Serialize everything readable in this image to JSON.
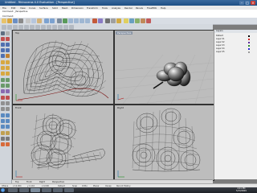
{
  "window": {
    "title": "Untitled - Rhinoceros 4.0 Evaluation - [Perspective]"
  },
  "menu": [
    "File",
    "Edit",
    "View",
    "Curve",
    "Surface",
    "Solid",
    "Mesh",
    "Dimension",
    "Transform",
    "Tools",
    "Analyze",
    "Render",
    "Panels",
    "FlowEDK",
    "Help"
  ],
  "command": {
    "history": "Command: _Perspective",
    "prompt": "Command:"
  },
  "viewports": [
    {
      "title": "Top"
    },
    {
      "title": "Perspective"
    },
    {
      "title": "Front"
    },
    {
      "title": "Right"
    }
  ],
  "layers": {
    "header": "Layers",
    "items": [
      {
        "name": "Default",
        "color": "#000000"
      },
      {
        "name": "Layer 01",
        "color": "#d22222"
      },
      {
        "name": "Layer 02",
        "color": "#5a2a9a"
      },
      {
        "name": "Layer 03",
        "color": "#2a8a2a"
      },
      {
        "name": "Layer 04",
        "color": "#2a2ad2"
      },
      {
        "name": "Layer 05",
        "color": "#999999"
      }
    ]
  },
  "viewport_tabs": [
    "Top",
    "Front",
    "Right",
    "Perspective"
  ],
  "status": [
    "CPlane",
    "x 12.004",
    "y 4.116",
    "z 0.000",
    "Default",
    "Snap",
    "Ortho",
    "Planar",
    "Osnap",
    "Record History"
  ],
  "taskbar": {
    "time": "4:21 PM",
    "date": "5/13/2009"
  }
}
